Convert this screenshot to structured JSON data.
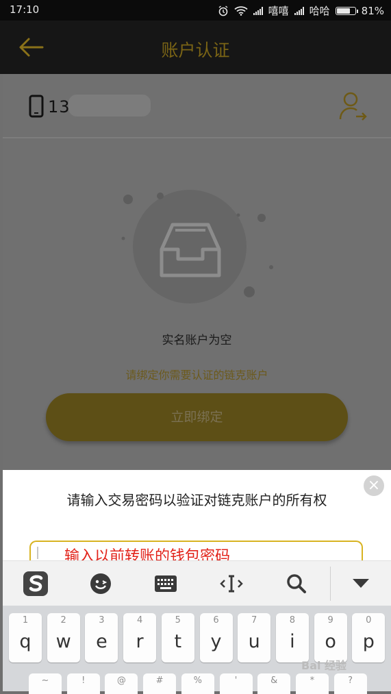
{
  "status_bar": {
    "time": "17:10",
    "carrier1": "嘻嘻",
    "carrier2": "哈哈",
    "battery": "81%",
    "battery_level": 0.81
  },
  "nav": {
    "title": "账户认证"
  },
  "phone": {
    "number": "13          73"
  },
  "empty_state": {
    "title": "实名账户为空",
    "hint": "请绑定你需要认证的链克账户",
    "bind_button": "立即绑定"
  },
  "dialog": {
    "message": "请输入交易密码以验证对链克账户的所有权",
    "annotation": "输入以前转账的钱包密码"
  },
  "keyboard": {
    "row1": [
      {
        "num": "1",
        "letter": "q"
      },
      {
        "num": "2",
        "letter": "w"
      },
      {
        "num": "3",
        "letter": "e"
      },
      {
        "num": "4",
        "letter": "r"
      },
      {
        "num": "5",
        "letter": "t"
      },
      {
        "num": "6",
        "letter": "y"
      },
      {
        "num": "7",
        "letter": "u"
      },
      {
        "num": "8",
        "letter": "i"
      },
      {
        "num": "9",
        "letter": "o"
      },
      {
        "num": "0",
        "letter": "p"
      }
    ],
    "row2": [
      "~",
      "!",
      "@",
      "#",
      "%",
      "'",
      "&",
      "*",
      "?"
    ]
  },
  "watermark": "Bai 经验",
  "colors": {
    "accent": "#d8b321",
    "nav_bg": "#161616",
    "annotation": "#e2231a"
  }
}
